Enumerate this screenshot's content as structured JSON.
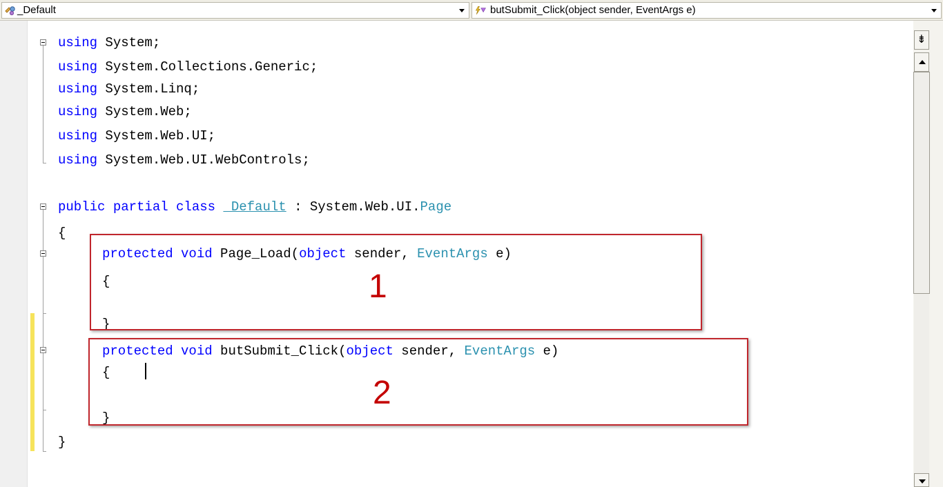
{
  "navbar": {
    "class_dropdown": {
      "icon": "class-icon",
      "label": "_Default"
    },
    "member_dropdown": {
      "icon": "method-event-icon",
      "label": "butSubmit_Click(object sender, EventArgs e)"
    }
  },
  "code": {
    "l1": {
      "kw": "using",
      "rest": " System;"
    },
    "l2": {
      "kw": "using",
      "rest": " System.Collections.Generic;"
    },
    "l3": {
      "kw": "using",
      "rest": " System.Linq;"
    },
    "l4": {
      "kw": "using",
      "rest": " System.Web;"
    },
    "l5": {
      "kw": "using",
      "rest": " System.Web.UI;"
    },
    "l6": {
      "kw": "using",
      "rest": " System.Web.UI.WebControls;"
    },
    "l8": {
      "kw": "public partial class",
      "sp": " ",
      "cls": "_Default",
      "mid": " : System.Web.UI.",
      "type": "Page"
    },
    "l9": "{",
    "l10": {
      "kw": "protected void",
      "name": " Page_Load(",
      "kw2": "object",
      "mid": " sender, ",
      "type": "EventArgs",
      "end": " e)"
    },
    "l11": "{",
    "l13": "}",
    "l14": {
      "kw": "protected void",
      "name": " butSubmit_Click(",
      "kw2": "object",
      "mid": " sender, ",
      "type": "EventArgs",
      "end": " e)"
    },
    "l15": "{",
    "l17": "}",
    "l18": "}"
  },
  "annotations": {
    "first": "1",
    "second": "2"
  },
  "scrollbar": {
    "split_glyph": "⇟"
  },
  "colors": {
    "keyword": "#0000ff",
    "type": "#2b91af",
    "annotation": "#c0262c",
    "change_bar": "#f6e35b"
  }
}
